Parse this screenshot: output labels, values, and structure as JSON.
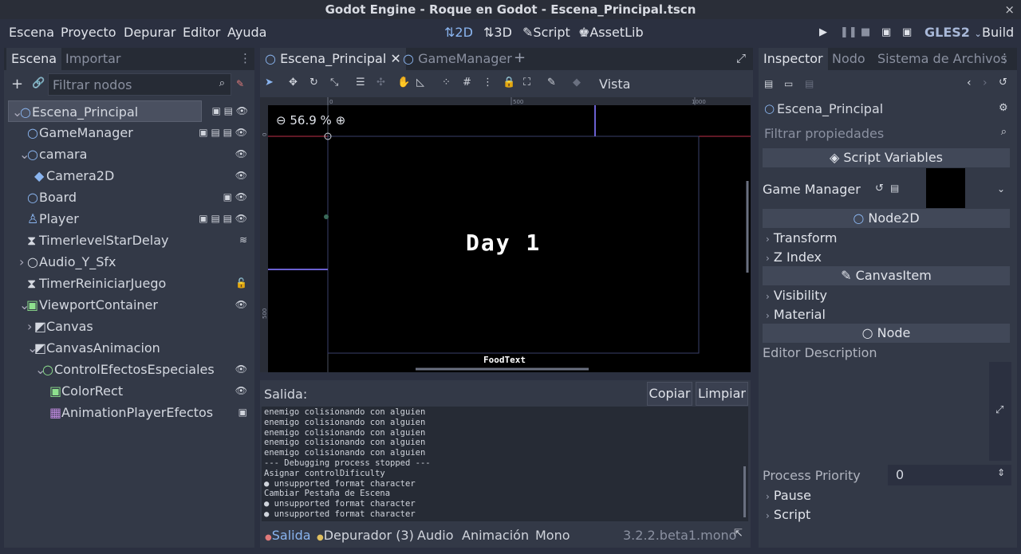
{
  "window": {
    "title": "Godot Engine - Roque en Godot - Escena_Principal.tscn",
    "close_glyph": "×"
  },
  "menu": {
    "items": [
      "Escena",
      "Proyecto",
      "Depurar",
      "Editor",
      "Ayuda"
    ]
  },
  "modes": {
    "m2d": "2D",
    "m3d": "3D",
    "script": "Script",
    "assetlib": "AssetLib"
  },
  "run": {
    "renderer": "GLES2",
    "build": "Build"
  },
  "scene_dock": {
    "tabs": [
      "Escena",
      "Importar"
    ],
    "filter_placeholder": "Filtrar nodos",
    "nodes": [
      {
        "label": "Escena_Principal"
      },
      {
        "label": "GameManager"
      },
      {
        "label": "camara"
      },
      {
        "label": "Camera2D"
      },
      {
        "label": "Board"
      },
      {
        "label": "Player"
      },
      {
        "label": "TimerlevelStarDelay"
      },
      {
        "label": "Audio_Y_Sfx"
      },
      {
        "label": "TimerReiniciarJuego"
      },
      {
        "label": "ViewportContainer"
      },
      {
        "label": "Canvas"
      },
      {
        "label": "CanvasAnimacion"
      },
      {
        "label": "ControlEfectosEspeciales"
      },
      {
        "label": "ColorRect"
      },
      {
        "label": "AnimationPlayerEfectos"
      }
    ]
  },
  "editor": {
    "tabs": [
      "Escena_Principal",
      "GameManager"
    ],
    "vista": "Vista",
    "zoom": "56.9 %",
    "ruler": {
      "t0": "0",
      "t500": "500",
      "t1000": "1000",
      "v0": "0",
      "v500": "500"
    },
    "canvas_text": {
      "day": "Day 1",
      "food": "FoodText"
    }
  },
  "output": {
    "label": "Salida:",
    "copy_button": "Copiar",
    "clear_button": "Limpiar",
    "lines": [
      {
        "text": "enemigo colisionando con alguien",
        "kind": "normal"
      },
      {
        "text": "enemigo colisionando con alguien",
        "kind": "normal"
      },
      {
        "text": "enemigo colisionando con alguien",
        "kind": "normal"
      },
      {
        "text": "enemigo colisionando con alguien",
        "kind": "normal"
      },
      {
        "text": "enemigo colisionando con alguien",
        "kind": "normal"
      },
      {
        "text": "--- Debugging process stopped ---",
        "kind": "dim"
      },
      {
        "text": "Asignar controlDificulty",
        "kind": "dim"
      },
      {
        "text": "● unsupported format character",
        "kind": "err"
      },
      {
        "text": "Cambiar Pestaña de Escena",
        "kind": "dim"
      },
      {
        "text": "● unsupported format character",
        "kind": "err"
      },
      {
        "text": "● unsupported format character",
        "kind": "err"
      }
    ]
  },
  "bottom_tabs": {
    "salida": "Salida",
    "depurador": "Depurador (3)",
    "audio": "Audio",
    "animacion": "Animación",
    "mono": "Mono",
    "version": "3.2.2.beta1.mono"
  },
  "inspector": {
    "tabs": [
      "Inspector",
      "Nodo",
      "Sistema de Archivos"
    ],
    "object_name": "Escena_Principal",
    "filter_placeholder": "Filtrar propiedades",
    "script_variables": "Script Variables",
    "game_manager_label": "Game Manager",
    "node2d_section": "Node2D",
    "transform": "Transform",
    "z_index": "Z Index",
    "canvas_item_section": "CanvasItem",
    "visibility": "Visibility",
    "material": "Material",
    "node_section": "Node",
    "editor_description": "Editor Description",
    "process_priority_label": "Process Priority",
    "process_priority_value": "0",
    "pause": "Pause",
    "script": "Script"
  },
  "colors": {
    "accent": "#8ab5f0",
    "error": "#e05a5a",
    "ruler_line": "#c0304a",
    "viewport_bg": "#000000"
  }
}
